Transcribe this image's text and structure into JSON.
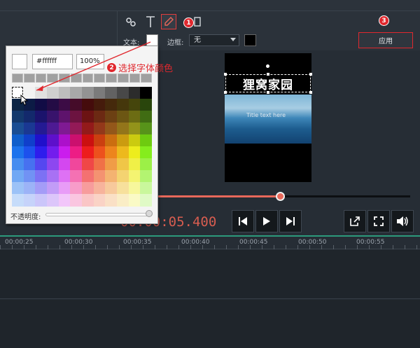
{
  "toolbar": {
    "text_label": "文本:",
    "border_label": "边框:",
    "border_value": "无",
    "apply_label": "应用",
    "step1": "1",
    "step3": "3"
  },
  "preview": {
    "title_text": "狸窝家园",
    "overlay_text": "Title text here"
  },
  "picker": {
    "hex_value": "#ffffff",
    "alpha_value": "100%",
    "opacity_label": "不透明度:"
  },
  "annotation": {
    "step2": "2",
    "text": "选择字体颜色"
  },
  "transport": {
    "timecode": "00:00:05.400"
  },
  "timeline": {
    "ticks": [
      "00:00:25",
      "00:00:30",
      "00:00:35",
      "00:00:40",
      "00:00:45",
      "00:00:50",
      "00:00:55"
    ]
  },
  "colors": {
    "accent_red": "#e0282e",
    "progress": "#e8685a",
    "timeline_green": "#2c9a7b"
  },
  "progress_fraction": 0.48
}
